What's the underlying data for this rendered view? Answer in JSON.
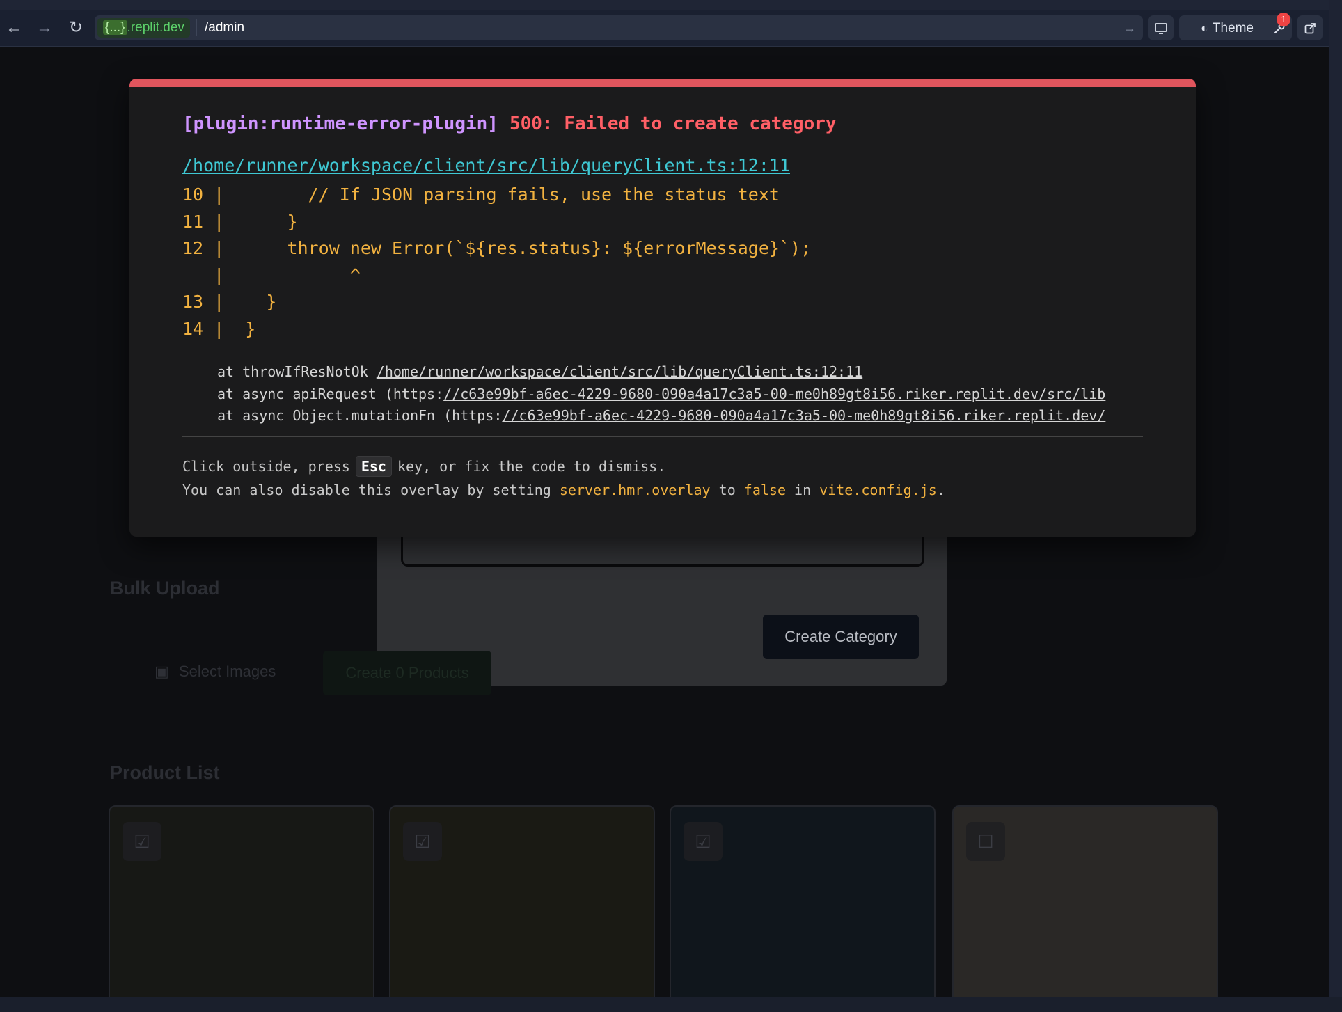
{
  "browser": {
    "host_brace": "{...}",
    "host_rest": ".replit.dev",
    "path": "/admin",
    "theme_label": "Theme",
    "notification_count": "1"
  },
  "app": {
    "bulk_upload_heading": "Bulk Upload",
    "select_images_label": "Select Images",
    "create_products_label": "Create 0 Products",
    "product_list_heading": "Product List",
    "create_category_label": "Create Category"
  },
  "error": {
    "plugin": "[plugin:runtime-error-plugin]",
    "message": "500: Failed to create category",
    "file_link": "/home/runner/workspace/client/src/lib/queryClient.ts:12:11",
    "code_lines": [
      "10 |        // If JSON parsing fails, use the status text",
      "11 |      }",
      "12 |      throw new Error(`${res.status}: ${errorMessage}`);",
      "   |            ^",
      "13 |    }",
      "14 |  }"
    ],
    "stack": [
      {
        "prefix": "at throwIfResNotOk ",
        "link": "/home/runner/workspace/client/src/lib/queryClient.ts:12:11"
      },
      {
        "prefix": "at async apiRequest (https:",
        "link": "//c63e99bf-a6ec-4229-9680-090a4a17c3a5-00-me0h89gt8i56.riker.replit.dev/src/lib"
      },
      {
        "prefix": "at async Object.mutationFn (https:",
        "link": "//c63e99bf-a6ec-4229-9680-090a4a17c3a5-00-me0h89gt8i56.riker.replit.dev/"
      }
    ],
    "tip1_before": "Click outside, press",
    "tip1_key": "Esc",
    "tip1_after": "key, or fix the code to dismiss.",
    "tip2_a": "You can also disable this overlay by setting ",
    "tip2_setting": "server.hmr.overlay",
    "tip2_b": " to ",
    "tip2_value": "false",
    "tip2_c": " in ",
    "tip2_file": "vite.config.js",
    "tip2_d": "."
  }
}
